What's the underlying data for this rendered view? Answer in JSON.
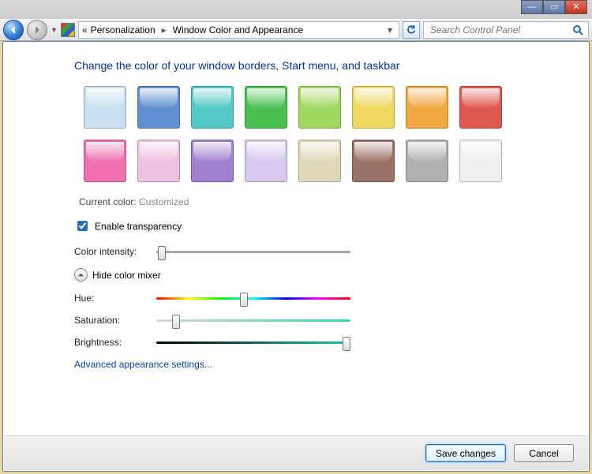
{
  "breadcrumb": {
    "parent": "Personalization",
    "current": "Window Color and Appearance"
  },
  "search": {
    "placeholder": "Search Control Panel"
  },
  "heading": "Change the color of your window borders, Start menu, and taskbar",
  "swatches_row1": [
    "#c8e0f0",
    "#5e8fd0",
    "#53c8c8",
    "#4ac050",
    "#a0d860",
    "#f0d860",
    "#f0a840",
    "#e05850"
  ],
  "swatches_row2": [
    "#f070b0",
    "#f0c0e0",
    "#a080d0",
    "#d8c8f0",
    "#e0d8b8",
    "#9c7268",
    "#b0b0b0",
    "#f0f0f0"
  ],
  "current_color": {
    "label": "Current color:",
    "value": "Customized"
  },
  "transparency": {
    "label": "Enable transparency",
    "checked": true
  },
  "intensity": {
    "label": "Color intensity:",
    "value": 3
  },
  "mixer": {
    "toggle_label": "Hide color mixer",
    "hue": {
      "label": "Hue:",
      "value": 45
    },
    "saturation": {
      "label": "Saturation:",
      "value": 10
    },
    "brightness": {
      "label": "Brightness:",
      "value": 98
    }
  },
  "advanced_link": "Advanced appearance settings...",
  "buttons": {
    "save": "Save changes",
    "cancel": "Cancel"
  }
}
